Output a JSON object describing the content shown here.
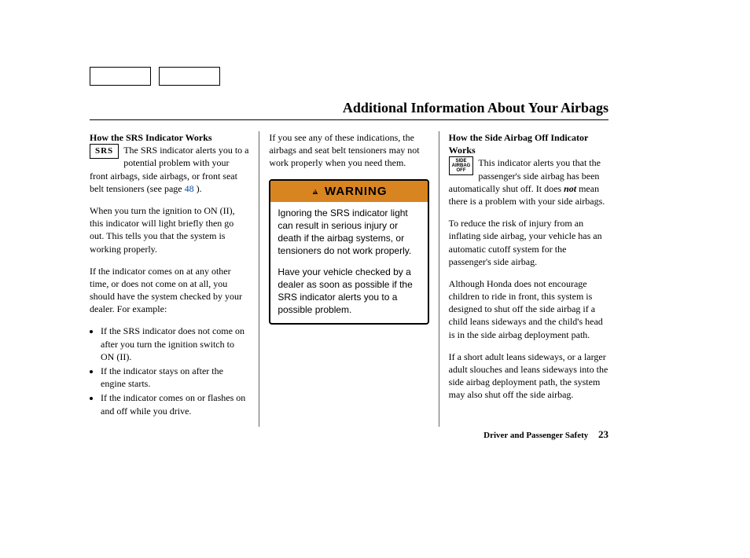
{
  "page_title": "Additional Information About Your Airbags",
  "col1": {
    "heading": "How the SRS Indicator Works",
    "chip": "SRS",
    "intro": "The SRS indicator alerts you to a potential problem with your front airbags, side airbags, or front seat belt tensioners (see page ",
    "page_link": "48",
    "intro_end": " ).",
    "p2": "When you turn the ignition to ON (II), this indicator will light briefly then go out. This tells you that the system is working properly.",
    "p3": "If the indicator comes on at any other time, or does not come on at all, you should have the system checked by your dealer. For example:",
    "b1": "If the SRS indicator does not come on after you turn the ignition switch to ON (II).",
    "b2": "If the indicator stays on after the engine starts.",
    "b3": "If the indicator comes on or flashes on and off while you drive."
  },
  "col2": {
    "p1": "If you see any of these indications, the airbags and seat belt tensioners may not work properly when you need them.",
    "warning_label": "WARNING",
    "warning_p1": "Ignoring the SRS indicator light can result in serious injury or death if the airbag systems, or tensioners do not work properly.",
    "warning_p2": "Have your vehicle checked by a dealer as soon as possible if the SRS indicator alerts you to a possible problem."
  },
  "col3": {
    "heading": "How the Side Airbag Off Indicator Works",
    "chip_l1": "SIDE",
    "chip_l2": "AIRBAG",
    "chip_l3": "OFF",
    "intro_a": "This indicator alerts you that the passenger's side airbag has been automatically shut off. It does ",
    "intro_not": "not",
    "intro_b": " mean there is a problem with your side airbags.",
    "p2": "To reduce the risk of injury from an inflating side airbag, your vehicle has an automatic cutoff system for the passenger's side airbag.",
    "p3": "Although Honda does not encourage children to ride in front, this system is designed to shut off the side airbag if a child leans sideways and the child's head is in the side airbag deployment path.",
    "p4": "If a short adult leans sideways, or a larger adult slouches and leans sideways into the side airbag deployment path, the system may also shut off the side airbag."
  },
  "footer": {
    "section": "Driver and Passenger Safety",
    "page": "23"
  }
}
